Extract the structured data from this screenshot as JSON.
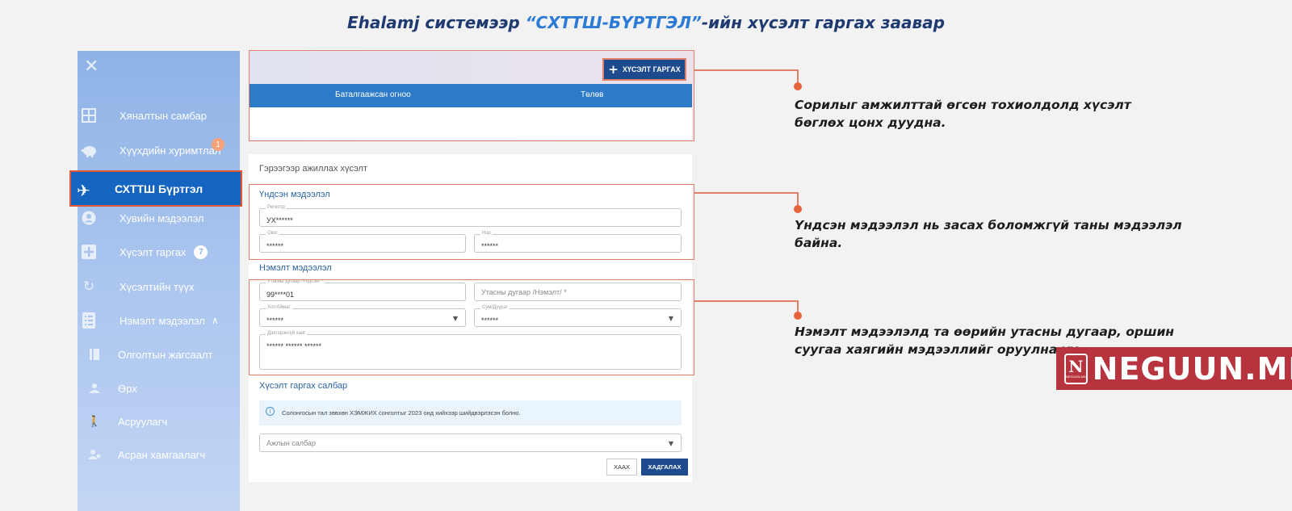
{
  "title": {
    "part1": "Ehalamj системээр ",
    "highlight": "“СХТТШ-БҮРТГЭЛ”",
    "part2": "-ийн хүсэлт гаргах заавар"
  },
  "sidebar": {
    "close_icon": "close-icon",
    "items": [
      {
        "label": "Хяналтын самбар",
        "icon": "dashboard-icon"
      },
      {
        "label": "Хүүхдийн хуримтлал",
        "icon": "piggy-bank-icon",
        "badge": "1"
      },
      {
        "label": "СХТТШ Бүртгэл",
        "icon": "airplane-icon",
        "active": true
      },
      {
        "label": "Хувийн мэдээлэл",
        "icon": "user-icon"
      },
      {
        "label": "Хүсэлт гаргах",
        "icon": "plus-icon",
        "badge": "7"
      },
      {
        "label": "Хүсэлтийн түүх",
        "icon": "history-icon"
      },
      {
        "label": "Нэмэлт мэдээлэл",
        "icon": "list-icon",
        "expanded": true
      },
      {
        "label": "Олголтын жагсаалт",
        "icon": "document-icon"
      },
      {
        "label": "Өрх",
        "icon": "household-icon"
      },
      {
        "label": "Асруулагч",
        "icon": "walking-person-icon"
      },
      {
        "label": "Асран хамгаалагч",
        "icon": "guardian-icon"
      }
    ]
  },
  "requests": {
    "create_button": "ХҮСЭЛТ ГАРГАХ",
    "columns": [
      "Баталгаажсан огноо",
      "Төлөв"
    ]
  },
  "form": {
    "heading": "Гэрээгээр ажиллах хүсэлт",
    "basic_title": "Үндсэн мэдээлэл",
    "register": {
      "label": "Регистр",
      "value": "УХ******"
    },
    "last_name": {
      "label": "Овог",
      "value": "******"
    },
    "first_name": {
      "label": "Нэр",
      "value": "******"
    },
    "extra_title": "Нэмэлт мэдээлэл",
    "phone_main": {
      "label": "Утасны дугаар /Үндсэн/ *",
      "value": "99****01"
    },
    "phone_extra": {
      "placeholder": "Утасны дугаар /Нэмэлт/ *"
    },
    "province": {
      "label": "Хот/Аймаг",
      "value": "******"
    },
    "district": {
      "label": "Сум/Дүүрэг",
      "value": "******"
    },
    "address": {
      "label": "Дэлгэрэнгүй хаяг",
      "value": "****** ****** ******"
    },
    "branch_title": "Хүсэлт гаргах салбар",
    "info_text": "Солонгосын тал зөвхөн ХЭМЖИХ сонголтыг 2023 онд хийхээр шийдвэрлэсэн болно.",
    "branch_select": {
      "placeholder": "Ажлын салбар"
    },
    "cancel": "ХААХ",
    "save": "ХАДГАЛАХ"
  },
  "callouts": [
    "Сорилыг амжилттай өгсөн тохиолдолд хүсэлт бөглөх цонх дуудна.",
    "Үндсэн мэдээлэл нь засах боломжгүй таны мэдээлэл байна.",
    "Нэмэлт мэдээлэлд та өөрийн утасны дугаар, оршин суугаа хаягийн мэдээллийг оруулна уу."
  ],
  "watermark": {
    "text": "NEGUUN.MN",
    "logo_text": "NEGUUN.MN"
  },
  "colors": {
    "accent": "#e2806b",
    "primary": "#1e4a8e",
    "header_blue": "#2d7ac8",
    "active": "#1565c0"
  }
}
